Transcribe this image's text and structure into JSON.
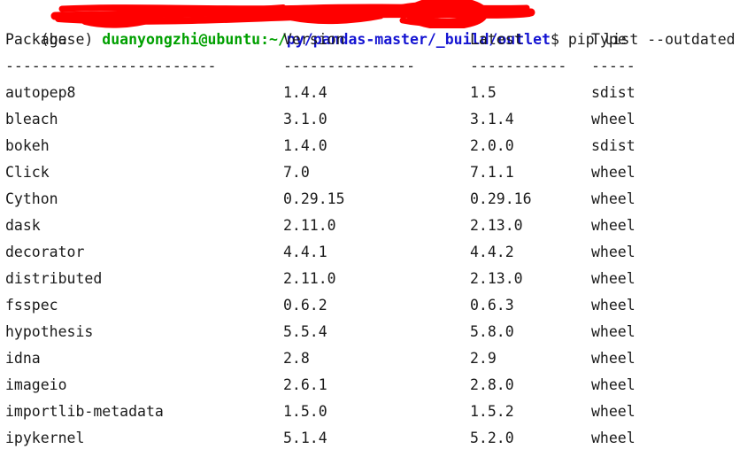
{
  "terminal": {
    "background_color": "#ffffff",
    "text_color": "#1a1a1a",
    "prompt": {
      "env_prefix": "(base) ",
      "user_host": "duanyongzhi@ubuntu:~/",
      "separator": "",
      "path": "py/pandas-master/_build/outlet",
      "dollar": "$ ",
      "command": "pip list --outdated",
      "user_host_color": "#00a000",
      "path_color": "#1414d2",
      "redaction_color": "#ff0000"
    }
  },
  "table": {
    "headers": {
      "package": "Package",
      "version": "Version",
      "latest": "Latest",
      "type": "Type"
    },
    "separators": {
      "package": "------------------------",
      "version": "---------------",
      "latest": "-----------",
      "type": "-----"
    },
    "rows": [
      {
        "package": "autopep8",
        "version": "1.4.4",
        "latest": "1.5",
        "type": "sdist"
      },
      {
        "package": "bleach",
        "version": "3.1.0",
        "latest": "3.1.4",
        "type": "wheel"
      },
      {
        "package": "bokeh",
        "version": "1.4.0",
        "latest": "2.0.0",
        "type": "sdist"
      },
      {
        "package": "Click",
        "version": "7.0",
        "latest": "7.1.1",
        "type": "wheel"
      },
      {
        "package": "Cython",
        "version": "0.29.15",
        "latest": "0.29.16",
        "type": "wheel"
      },
      {
        "package": "dask",
        "version": "2.11.0",
        "latest": "2.13.0",
        "type": "wheel"
      },
      {
        "package": "decorator",
        "version": "4.4.1",
        "latest": "4.4.2",
        "type": "wheel"
      },
      {
        "package": "distributed",
        "version": "2.11.0",
        "latest": "2.13.0",
        "type": "wheel"
      },
      {
        "package": "fsspec",
        "version": "0.6.2",
        "latest": "0.6.3",
        "type": "wheel"
      },
      {
        "package": "hypothesis",
        "version": "5.5.4",
        "latest": "5.8.0",
        "type": "wheel"
      },
      {
        "package": "idna",
        "version": "2.8",
        "latest": "2.9",
        "type": "wheel"
      },
      {
        "package": "imageio",
        "version": "2.6.1",
        "latest": "2.8.0",
        "type": "wheel"
      },
      {
        "package": "importlib-metadata",
        "version": "1.5.0",
        "latest": "1.5.2",
        "type": "wheel"
      },
      {
        "package": "ipykernel",
        "version": "5.1.4",
        "latest": "5.2.0",
        "type": "wheel"
      }
    ]
  }
}
